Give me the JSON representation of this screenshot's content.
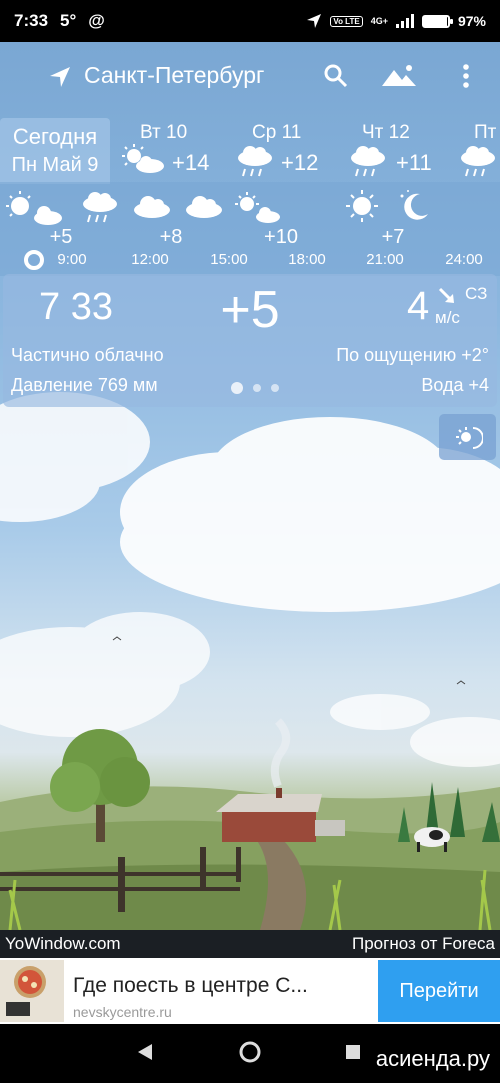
{
  "status": {
    "time": "7:33",
    "temp": "5°",
    "at_icon": "@",
    "network": "4G+",
    "volte": "Vo LTE",
    "battery": "97%",
    "battery_level": 0.97
  },
  "header": {
    "city": "Санкт-Петербург",
    "icons": [
      "location-arrow-icon",
      "search-icon",
      "landscape-icon",
      "more-vert-icon"
    ]
  },
  "today": {
    "label": "Сегодня",
    "date": "Пн Май 9"
  },
  "days": [
    {
      "name": "Вт 10",
      "temp": "+14",
      "icon": "partly-cloudy-icon"
    },
    {
      "name": "Ср 11",
      "temp": "+12",
      "icon": "rain-cloud-icon"
    },
    {
      "name": "Чт 12",
      "temp": "+11",
      "icon": "rain-cloud-icon"
    },
    {
      "name": "Пт",
      "temp": "",
      "icon": "rain-cloud-icon"
    }
  ],
  "hourly": {
    "temps": [
      "+5",
      "+8",
      "+10",
      "+7"
    ],
    "times": [
      "9:00",
      "12:00",
      "15:00",
      "18:00",
      "21:00",
      "24:00"
    ],
    "icons": [
      "partly-cloudy-icon",
      "rain-cloud-icon",
      "cloud-icon",
      "cloud-icon",
      "partly-cloudy-icon",
      "sun-icon",
      "moon-icon"
    ]
  },
  "current": {
    "time": "7 33",
    "temp": "+5",
    "wind_speed": "4",
    "wind_dir": "СЗ",
    "wind_unit": "м/с",
    "condition": "Частично облачно",
    "feels_like": "По ощущению +2°",
    "pressure": "Давление 769 мм",
    "water": "Вода +4"
  },
  "footer": {
    "left": "YoWindow.com",
    "right": "Прогноз от Foreca"
  },
  "ad": {
    "title": "Где поесть в центре С...",
    "url": "nevskycentre.ru",
    "button": "Перейти"
  },
  "watermark": "асиенда.ру"
}
